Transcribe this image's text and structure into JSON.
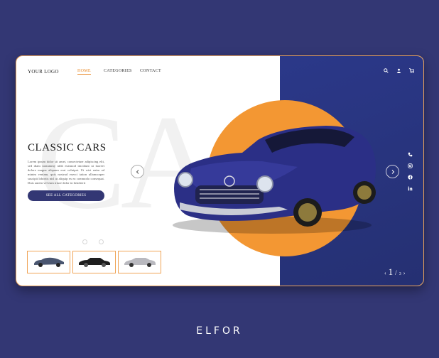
{
  "header": {
    "logo": "YOUR LOGO",
    "nav": [
      "HOME",
      "CATEGORIES",
      "CONTACT"
    ]
  },
  "hero": {
    "background_letters": "CA",
    "title": "CLASSIC CARS",
    "description": "Lorem ipsum dolor sit amet, consectetuer adipiscing elit, sed diam nonummy nibh euismod tincidunt ut laoreet dolore magna aliquam erat volutpat. Ut wisi enim ad minim veniam, quis nostrud exerci tation ullamcorper suscipit lobortis nisl ut aliquip ex ea commodo consequat. Duis autem vel eum iriure dolor in hendrerit",
    "cta": "SEE ALL CATEGORIES"
  },
  "pager": {
    "current": "1",
    "separator": "/",
    "total": "3"
  },
  "brand": "ELFOR",
  "colors": {
    "navy": "#333774",
    "accent": "#f39733",
    "panel": "#2b3889"
  },
  "icons": {
    "top": [
      "search-icon",
      "user-icon",
      "cart-icon"
    ],
    "social": [
      "phone-icon",
      "instagram-icon",
      "facebook-icon",
      "linkedin-icon"
    ]
  }
}
